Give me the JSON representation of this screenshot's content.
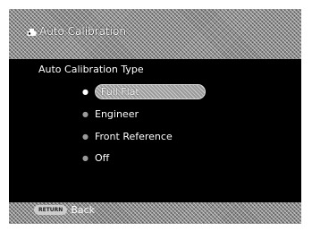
{
  "header": {
    "title": "Auto Calibration",
    "title_icon": "projector-icon"
  },
  "main": {
    "section_label": "Auto Calibration Type",
    "options": [
      {
        "label": "Full Flat",
        "selected": true
      },
      {
        "label": "Engineer",
        "selected": false
      },
      {
        "label": "Front Reference",
        "selected": false
      },
      {
        "label": "Off",
        "selected": false
      }
    ]
  },
  "footer": {
    "return_key_label": "RETURN",
    "back_label": "Back"
  },
  "colors": {
    "background": "#000000",
    "bar_hatch": "#8a8a8a",
    "text": "#ffffff"
  }
}
